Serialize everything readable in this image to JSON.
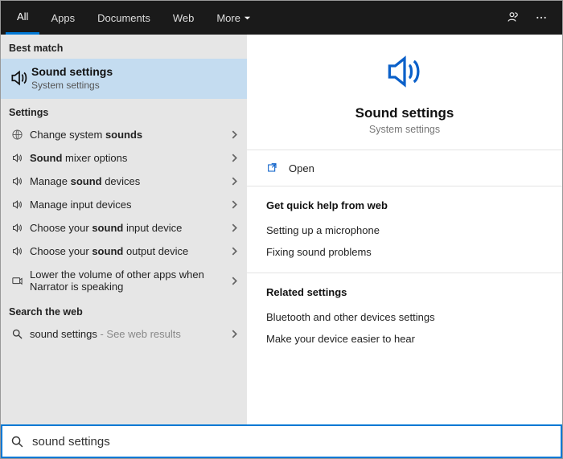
{
  "topbar": {
    "tabs": [
      {
        "label": "All",
        "active": true
      },
      {
        "label": "Apps",
        "active": false
      },
      {
        "label": "Documents",
        "active": false
      },
      {
        "label": "Web",
        "active": false
      },
      {
        "label": "More",
        "active": false,
        "dropdown": true
      }
    ]
  },
  "left": {
    "best_match_header": "Best match",
    "best_match": {
      "title": "Sound settings",
      "subtitle": "System settings"
    },
    "settings_header": "Settings",
    "settings_items": [
      {
        "icon": "globe",
        "html": "Change system <b>sounds</b>"
      },
      {
        "icon": "speaker",
        "html": "<b>Sound</b> mixer options"
      },
      {
        "icon": "speaker",
        "html": "Manage <b>sound</b> devices"
      },
      {
        "icon": "speaker",
        "html": "Manage input devices"
      },
      {
        "icon": "speaker",
        "html": "Choose your <b>sound</b> input device"
      },
      {
        "icon": "speaker",
        "html": "Choose your <b>sound</b> output device"
      },
      {
        "icon": "narrator",
        "html": "Lower the volume of other apps when Narrator is speaking"
      }
    ],
    "web_header": "Search the web",
    "web_item": {
      "text": "sound settings",
      "suffix": " - See web results"
    }
  },
  "right": {
    "title": "Sound settings",
    "subtitle": "System settings",
    "open_label": "Open",
    "quick_help_header": "Get quick help from web",
    "quick_help_links": [
      "Setting up a microphone",
      "Fixing sound problems"
    ],
    "related_header": "Related settings",
    "related_links": [
      "Bluetooth and other devices settings",
      "Make your device easier to hear"
    ]
  },
  "search": {
    "value": "sound settings"
  }
}
